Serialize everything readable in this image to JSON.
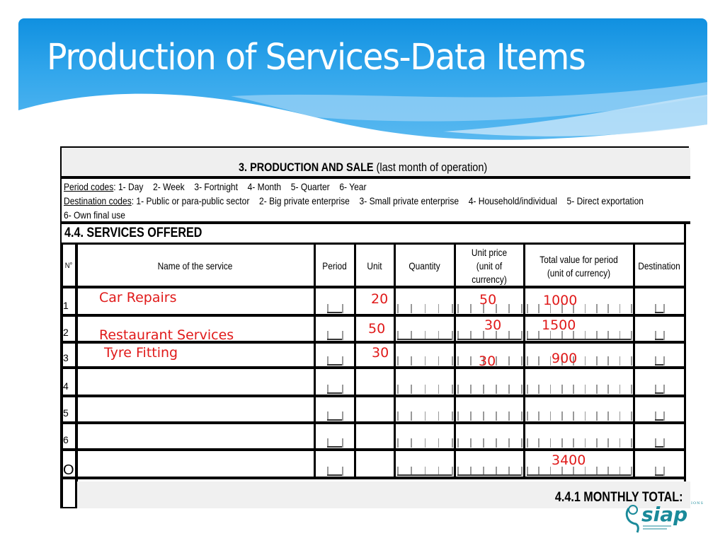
{
  "slide": {
    "title": "Production of Services-Data Items",
    "colors": {
      "banner_top": "#1090e0",
      "banner_bottom": "#5ab9f0",
      "annotation": "#e01a1a"
    }
  },
  "form": {
    "header_bold": "3. PRODUCTION AND SALE",
    "header_normal": " (last month of operation)",
    "period_codes_label": "Period codes",
    "period_codes": [
      "1- Day",
      "2- Week",
      "3- Fortnight",
      "4- Month",
      "5- Quarter",
      "6- Year"
    ],
    "destination_codes_label": "Destination codes",
    "destination_codes": [
      "1- Public or para-public sector",
      "2- Big private enterprise",
      "3- Small private enterprise",
      "4- Household/individual",
      "5- Direct exportation"
    ],
    "destination_codes_line2": "6- Own final use",
    "section_title": "4.4.   SERVICES OFFERED",
    "columns": {
      "no": "N°",
      "name": "Name of the service",
      "period": "Period",
      "unit": "Unit",
      "quantity": "Quantity",
      "unit_price_1": "Unit price",
      "unit_price_2": "(unit of",
      "unit_price_3": "currency)",
      "total_1": "Total value for period",
      "total_2": "(unit of currency)",
      "destination": "Destination"
    },
    "rows": [
      {
        "no": "1",
        "name": "Car Repairs",
        "unit": "20",
        "unit_price": "50",
        "total": "1000"
      },
      {
        "no": "2",
        "name": "Restaurant Services",
        "unit": "50",
        "unit_price": "30",
        "total": "1500"
      },
      {
        "no": "3",
        "name": "Tyre Fitting",
        "unit": "30",
        "unit_price": "30",
        "total": "900"
      },
      {
        "no": "4",
        "name": "",
        "unit": "",
        "unit_price": "",
        "total": ""
      },
      {
        "no": "5",
        "name": "",
        "unit": "",
        "unit_price": "",
        "total": ""
      },
      {
        "no": "6",
        "name": "",
        "unit": "",
        "unit_price": "",
        "total": ""
      },
      {
        "no": "O",
        "name": "",
        "unit": "",
        "unit_price": "",
        "total": "3400"
      }
    ],
    "monthly_total_label": "4.4.1  MONTHLY TOTAL:"
  },
  "logo": {
    "text": "siap",
    "small_text": "IONS",
    "icon": "siap-logo-icon"
  }
}
